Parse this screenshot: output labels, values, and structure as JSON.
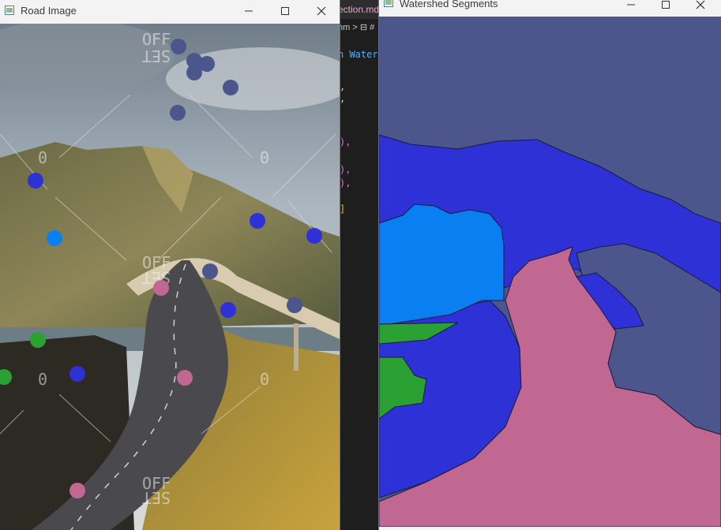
{
  "editor": {
    "tab_label": "ection.md",
    "breadcrumb": "hm > ⊟ #",
    "code_line": "n Waters"
  },
  "road_window": {
    "title": "Road Image",
    "marker_labels": [
      "OFF",
      "SET",
      "0",
      "0",
      "OFF",
      "SET",
      "0",
      "0",
      "OFF",
      "SET"
    ]
  },
  "watershed_window": {
    "title": "Watershed Segments"
  },
  "colors": {
    "seg_slate": "#4c558c",
    "seg_blue": "#2d31d6",
    "seg_sky": "#0a7ff2",
    "seg_green": "#2aa132",
    "seg_pink": "#c06891"
  },
  "icons": {
    "minimize": "minimize-icon",
    "maximize": "maximize-icon",
    "close": "close-icon",
    "app": "app-window-icon"
  }
}
